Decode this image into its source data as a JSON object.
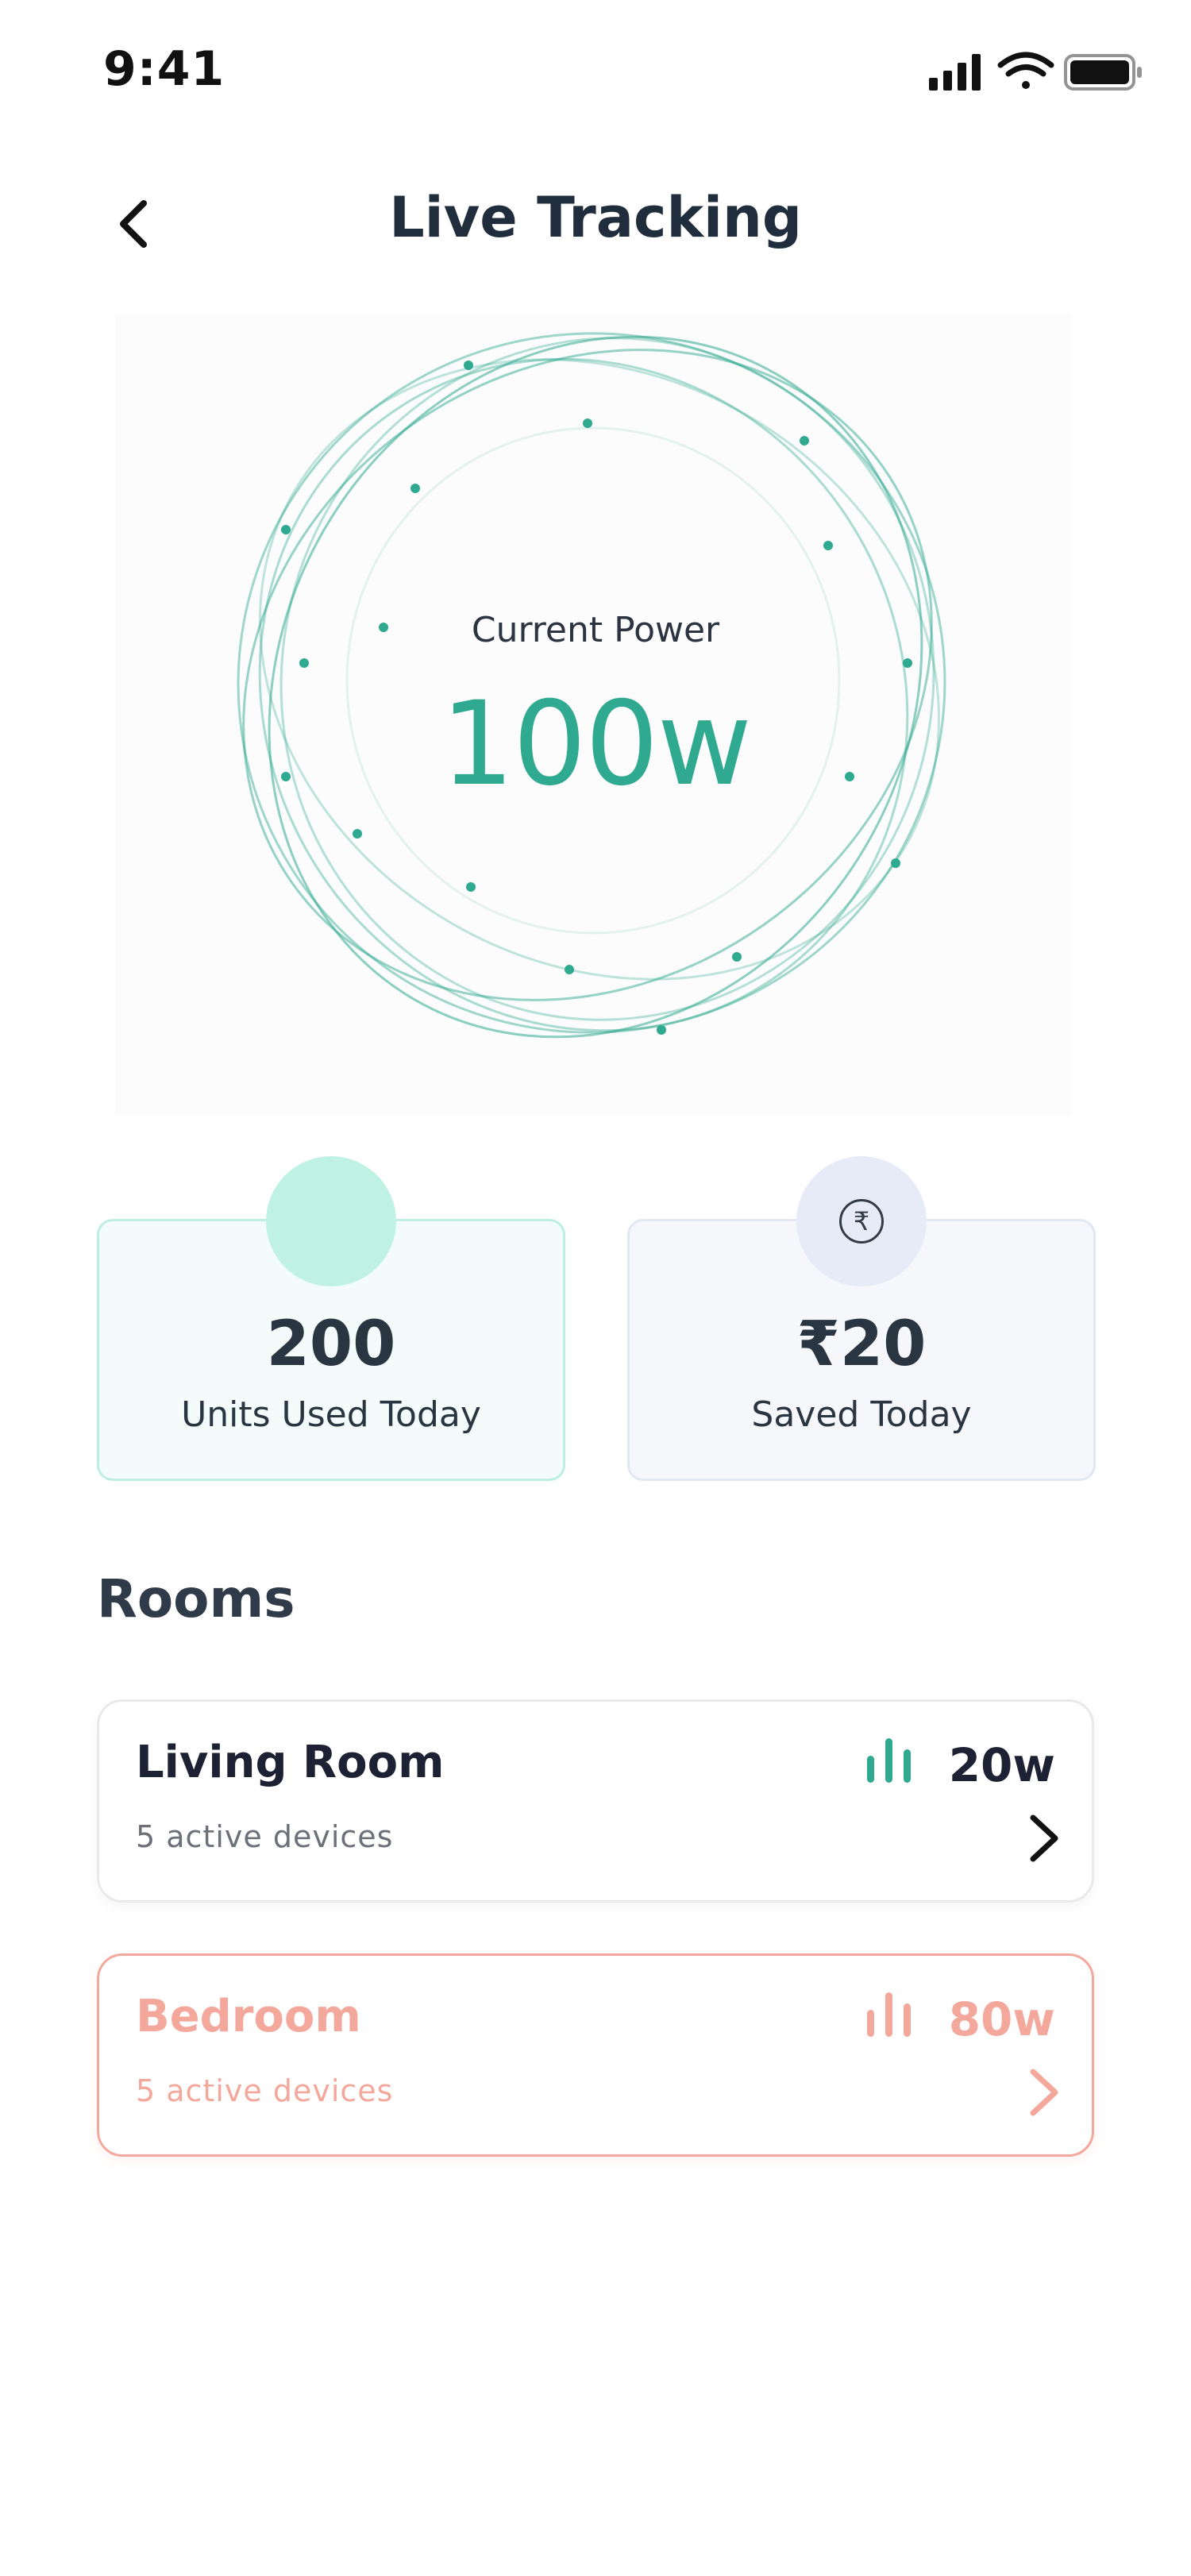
{
  "status_bar": {
    "time": "9:41",
    "icons": [
      "cellular-signal-icon",
      "wifi-icon",
      "battery-icon"
    ]
  },
  "header": {
    "title": "Live Tracking",
    "back_icon": "chevron-left-icon"
  },
  "current_power": {
    "label": "Current Power",
    "value": "100w",
    "accent_color": "#2fa98f"
  },
  "stats": [
    {
      "value": "200",
      "label": "Units Used Today",
      "icon": "",
      "color": "#bff2e3"
    },
    {
      "value": "₹20",
      "label": "Saved Today",
      "icon": "rupee-icon",
      "icon_glyph": "₹",
      "color": "#e7ebf7"
    }
  ],
  "rooms_section": {
    "title": "Rooms",
    "rooms": [
      {
        "name": "Living Room",
        "devices": "5 active devices",
        "power": "20w",
        "color": "#1c2233",
        "accent": "#2fa98f",
        "state": "normal"
      },
      {
        "name": "Bedroom",
        "devices": "5 active devices",
        "power": "80w",
        "color": "#f4a89c",
        "accent": "#f4a89c",
        "state": "highlighted"
      }
    ]
  }
}
